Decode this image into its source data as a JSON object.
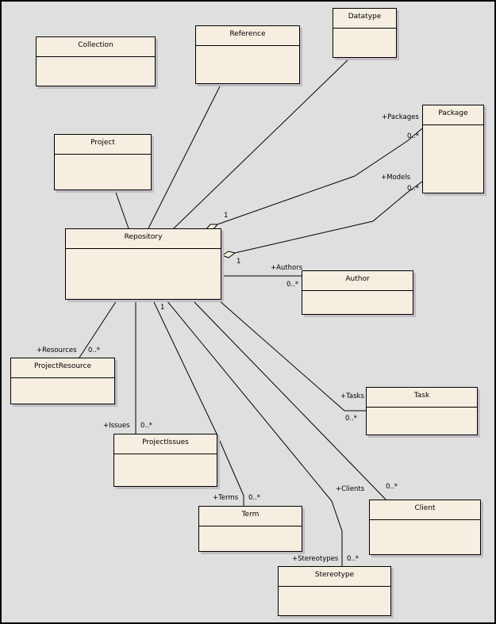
{
  "diagram": {
    "type": "UML class diagram",
    "classes": [
      {
        "id": "collection",
        "name": "Collection"
      },
      {
        "id": "reference",
        "name": "Reference"
      },
      {
        "id": "datatype",
        "name": "Datatype"
      },
      {
        "id": "project",
        "name": "Project"
      },
      {
        "id": "package",
        "name": "Package"
      },
      {
        "id": "repository",
        "name": "Repository"
      },
      {
        "id": "author",
        "name": "Author"
      },
      {
        "id": "projectresource",
        "name": "ProjectResource"
      },
      {
        "id": "task",
        "name": "Task"
      },
      {
        "id": "projectissues",
        "name": "ProjectIssues"
      },
      {
        "id": "client",
        "name": "Client"
      },
      {
        "id": "term",
        "name": "Term"
      },
      {
        "id": "stereotype",
        "name": "Stereotype"
      }
    ],
    "associations": [
      {
        "from": "Repository",
        "to": "Project",
        "kind": "association"
      },
      {
        "from": "Repository",
        "to": "Reference",
        "kind": "association"
      },
      {
        "from": "Repository",
        "to": "Datatype",
        "kind": "association"
      },
      {
        "from": "Repository",
        "to": "Package",
        "kind": "aggregation",
        "source_multiplicity": "1",
        "role": "+Packages",
        "target_multiplicity": "0..*"
      },
      {
        "from": "Repository",
        "to": "Package",
        "kind": "aggregation",
        "source_multiplicity": "1",
        "role": "+Models",
        "target_multiplicity": "0..*"
      },
      {
        "from": "Repository",
        "to": "Author",
        "kind": "association",
        "role": "+Authors",
        "target_multiplicity": "0..*"
      },
      {
        "from": "Repository",
        "to": "ProjectResource",
        "kind": "association",
        "role": "+Resources",
        "target_multiplicity": "0..*"
      },
      {
        "from": "Repository",
        "to": "ProjectIssues",
        "kind": "association",
        "role": "+Issues",
        "target_multiplicity": "0..*"
      },
      {
        "from": "Repository",
        "to": "Term",
        "kind": "association",
        "source_multiplicity": "1",
        "role": "+Terms",
        "target_multiplicity": "0..*"
      },
      {
        "from": "Repository",
        "to": "Stereotype",
        "kind": "association",
        "role": "+Stereotypes",
        "target_multiplicity": "0..*"
      },
      {
        "from": "Repository",
        "to": "Client",
        "kind": "association",
        "role": "+Clients",
        "target_multiplicity": "0..*"
      },
      {
        "from": "Repository",
        "to": "Task",
        "kind": "association",
        "role": "+Tasks",
        "target_multiplicity": "0..*"
      }
    ],
    "labels": {
      "packages_role": "+Packages",
      "packages_mult": "0..*",
      "packages_src_mult": "1",
      "models_role": "+Models",
      "models_mult": "0..*",
      "models_src_mult": "1",
      "authors_role": "+Authors",
      "authors_mult": "0..*",
      "resources_role": "+Resources",
      "resources_mult": "0..*",
      "issues_role": "+Issues",
      "issues_mult": "0..*",
      "terms_src_mult": "1",
      "terms_role": "+Terms",
      "terms_mult": "0..*",
      "tasks_role": "+Tasks",
      "tasks_mult": "0..*",
      "clients_role": "+Clients",
      "clients_mult": "0..*",
      "stereotypes_role": "+Stereotypes",
      "stereotypes_mult": "0..*"
    },
    "colors": {
      "background": "#dfdfdf",
      "class_fill": "#f6efe1",
      "class_shadow": "#c2bcc4",
      "line": "#000000"
    }
  }
}
